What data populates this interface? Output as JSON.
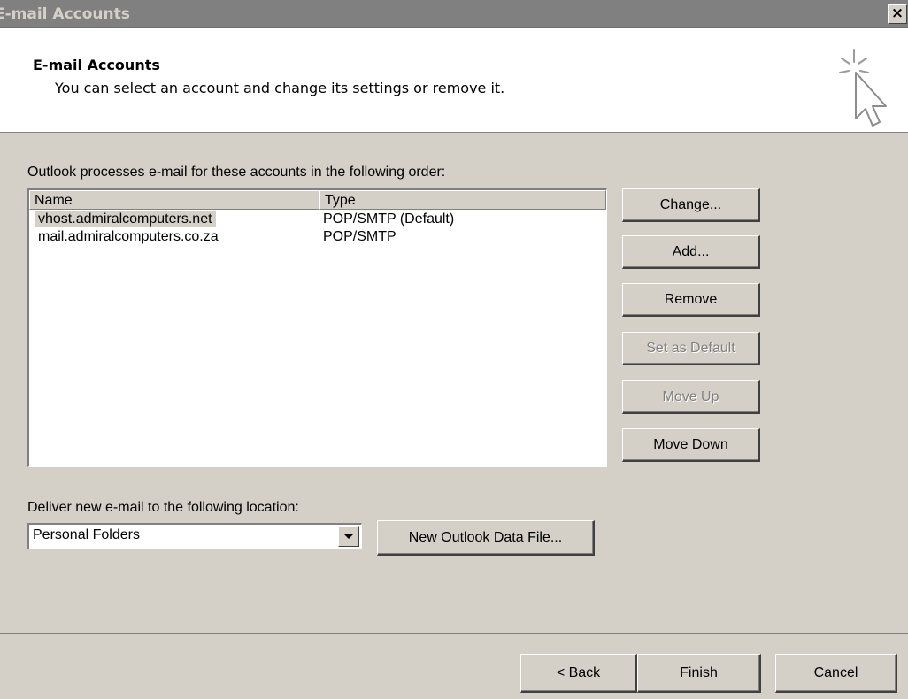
{
  "window": {
    "title": "E-mail Accounts",
    "close_label": "×"
  },
  "header": {
    "title": "E-mail Accounts",
    "subtitle": "You can select an account and change its settings or remove it.",
    "icon": "wizard-cursor-icon"
  },
  "accounts": {
    "label": "Outlook processes e-mail for these accounts in the following order:",
    "columns": {
      "name": "Name",
      "type": "Type"
    },
    "rows": [
      {
        "name": "vhost.admiralcomputers.net",
        "type": "POP/SMTP (Default)"
      },
      {
        "name": "mail.admiralcomputers.co.za",
        "type": "POP/SMTP"
      }
    ],
    "selected_index": 0
  },
  "side_buttons": {
    "change": "Change...",
    "add": "Add...",
    "remove": "Remove",
    "set_default": "Set as Default",
    "move_up": "Move Up",
    "move_down": "Move Down"
  },
  "delivery": {
    "label": "Deliver new e-mail to the following location:",
    "selected": "Personal Folders",
    "new_data_file": "New Outlook Data File..."
  },
  "footer": {
    "back": "< Back",
    "finish": "Finish",
    "cancel": "Cancel"
  }
}
